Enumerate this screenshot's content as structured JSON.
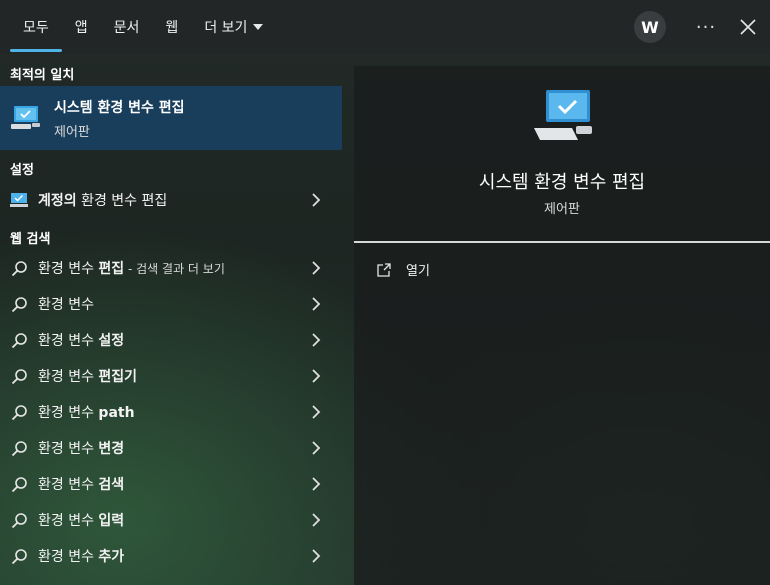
{
  "tabs": [
    {
      "label": "모두",
      "active": true
    },
    {
      "label": "앱"
    },
    {
      "label": "문서"
    },
    {
      "label": "웹"
    },
    {
      "label": "더 보기"
    }
  ],
  "account": {
    "initial": "W"
  },
  "more_label": "···",
  "best_match": {
    "section": "최적의 일치",
    "title": "시스템 환경 변수 편집",
    "subtitle": "제어판"
  },
  "settings": {
    "section": "설정",
    "item": {
      "bold": "계정의",
      "rest": " 환경 변수 편집"
    }
  },
  "web": {
    "section": "웹 검색",
    "items": [
      {
        "plain": "환경 변수 ",
        "bold": "편집",
        "suffix": " - 검색 결과 더 보기"
      },
      {
        "plain": "환경 변수",
        "bold": "",
        "suffix": ""
      },
      {
        "plain": "환경 변수 ",
        "bold": "설정",
        "suffix": ""
      },
      {
        "plain": "환경 변수 ",
        "bold": "편집기",
        "suffix": ""
      },
      {
        "plain": "환경 변수 ",
        "bold": "path",
        "suffix": ""
      },
      {
        "plain": "환경 변수 ",
        "bold": "변경",
        "suffix": ""
      },
      {
        "plain": "환경 변수 ",
        "bold": "검색",
        "suffix": ""
      },
      {
        "plain": "환경 변수 ",
        "bold": "입력",
        "suffix": ""
      },
      {
        "plain": "환경 변수 ",
        "bold": "추가",
        "suffix": ""
      }
    ]
  },
  "preview": {
    "title": "시스템 환경 변수 편집",
    "subtitle": "제어판",
    "open_label": "열기"
  },
  "colors": {
    "accent": "#4fb3e8",
    "selected": "#183e5c"
  }
}
